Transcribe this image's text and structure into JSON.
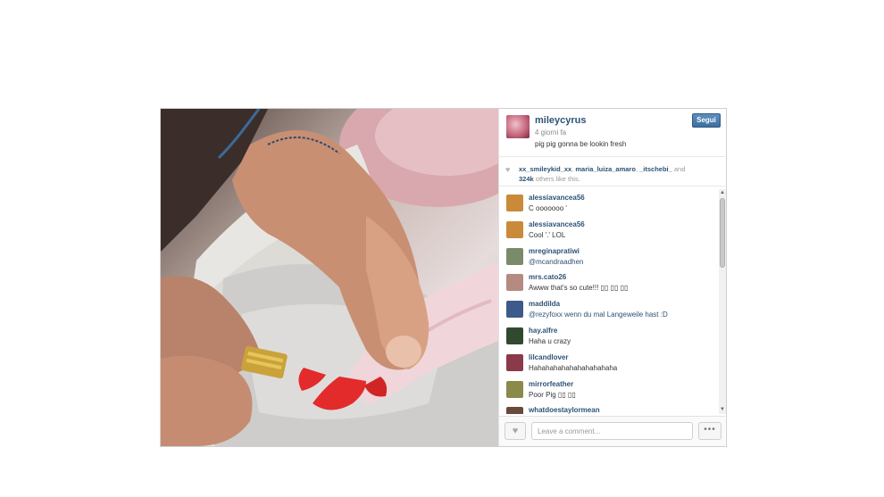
{
  "post": {
    "username": "mileycyrus",
    "time": "4 giorni fa",
    "caption": "pig pig gonna be lookin fresh",
    "follow_label": "Segui"
  },
  "likes": {
    "users": [
      "xx_smileykid_xx",
      "maria_luiza_amaro",
      "_itschebi_"
    ],
    "sep1": ", ",
    "sep2": ", ",
    "and": " and ",
    "count": "324k",
    "suffix": " others like this."
  },
  "comments": [
    {
      "user": "alessiavancea56",
      "text": "C ooooooo '",
      "avatar_color": "#c98a3a"
    },
    {
      "user": "alessiavancea56",
      "text": "Cool '.' LOL",
      "avatar_color": "#c98a3a"
    },
    {
      "user": "mreginapratiwi",
      "text": "@mcandraadhen",
      "avatar_color": "#7a8a6a"
    },
    {
      "user": "mrs.cato26",
      "text": "Awww that's so cute!!! ▯▯ ▯▯ ▯▯",
      "avatar_color": "#b58a80"
    },
    {
      "user": "maddilda",
      "text": "@rezyfoxx wenn du mal Langeweile hast :D",
      "avatar_color": "#3c5a8a"
    },
    {
      "user": "hay.alfre",
      "text": "Haha u crazy",
      "avatar_color": "#2f4a2f"
    },
    {
      "user": "lilcandlover",
      "text": "Hahahahahahahahahahaha",
      "avatar_color": "#8a3a4a"
    },
    {
      "user": "mirrorfeather",
      "text": "Poor Pig ▯▯ ▯▯",
      "avatar_color": "#8a8a4a"
    },
    {
      "user": "whatdoestaylormean",
      "text": "",
      "avatar_color": "#6a4a3a"
    }
  ],
  "footer": {
    "comment_placeholder": "Leave a comment...",
    "more_label": "•••"
  },
  "icons": {
    "heart": "heart-icon",
    "more": "more-options-icon",
    "scroll_up": "scroll-up-arrow-icon",
    "scroll_down": "scroll-down-arrow-icon"
  },
  "colors": {
    "link": "#2d5377",
    "follow_button": "#3e6f9d",
    "nail_polish": "#e32b2b"
  }
}
